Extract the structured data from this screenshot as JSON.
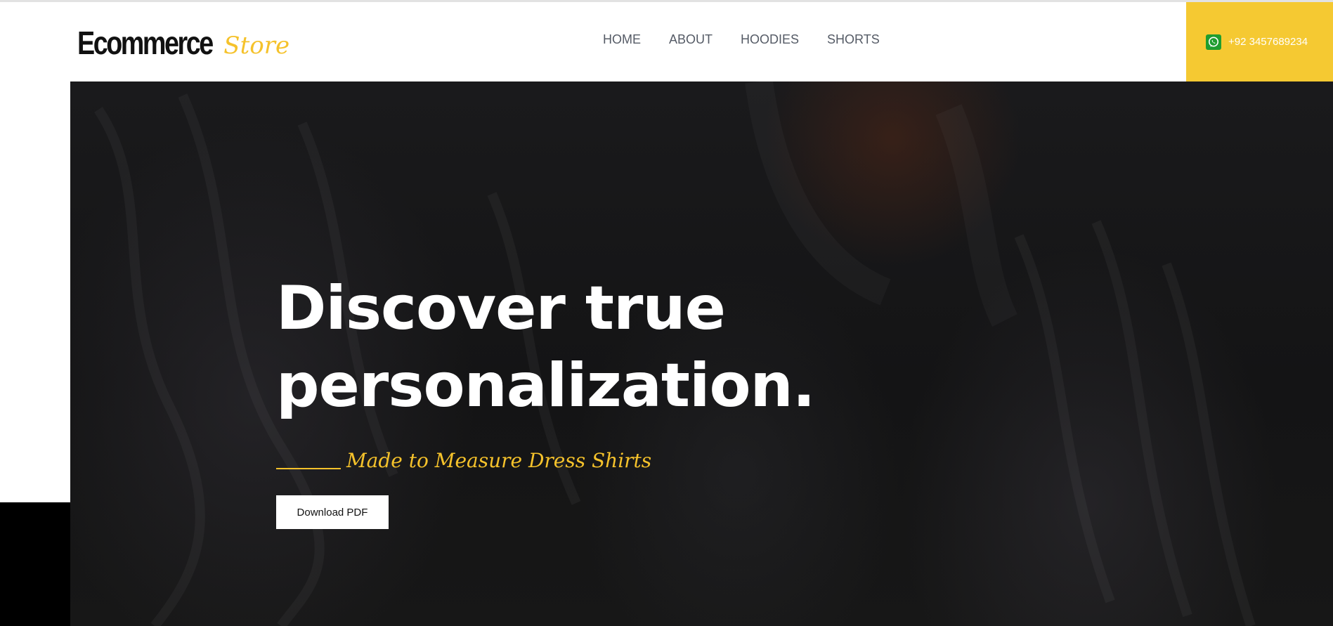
{
  "header": {
    "logo_main": "Ecommerce",
    "logo_accent": "Store",
    "nav": [
      {
        "label": "HOME"
      },
      {
        "label": "ABOUT"
      },
      {
        "label": "HOODIES"
      },
      {
        "label": "SHORTS"
      }
    ],
    "phone": "+92 3457689234",
    "phone_icon": "whatsapp-icon"
  },
  "hero": {
    "title_line1": "Discover true",
    "title_line2": "personalization.",
    "tagline": "Made to Measure Dress Shirts",
    "cta_label": "Download PDF"
  },
  "colors": {
    "accent": "#f5c932",
    "hero_overlay": "#141415",
    "whatsapp": "#1f9d2f"
  }
}
